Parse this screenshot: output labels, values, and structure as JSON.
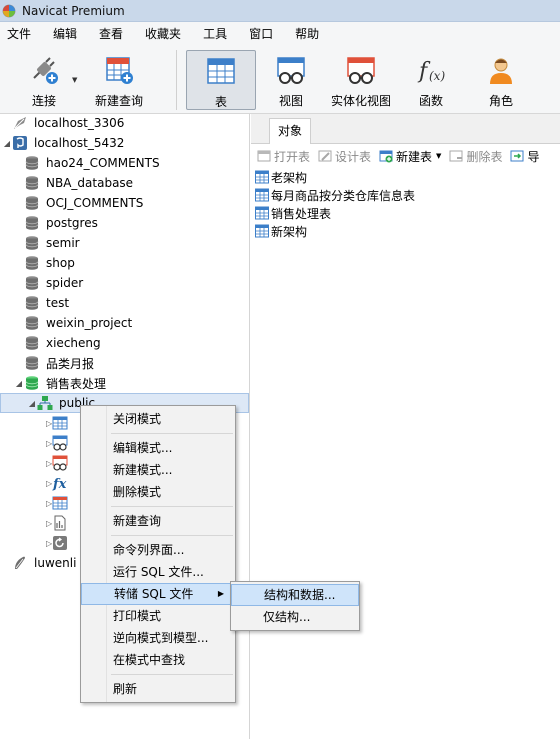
{
  "window": {
    "title": "Navicat Premium"
  },
  "menubar": [
    "文件",
    "编辑",
    "查看",
    "收藏夹",
    "工具",
    "窗口",
    "帮助"
  ],
  "toolbar": {
    "connect": "连接",
    "new_query": "新建查询",
    "table": "表",
    "view": "视图",
    "materialized_view": "实体化视图",
    "function": "函数",
    "role": "角色"
  },
  "tree": {
    "conn_mysql": "localhost_3306",
    "conn_pg": "localhost_5432",
    "databases": [
      "hao24_COMMENTS",
      "NBA_database",
      "OCJ_COMMENTS",
      "postgres",
      "semir",
      "shop",
      "spider",
      "test",
      "weixin_project",
      "xiecheng",
      "品类月报"
    ],
    "open_db": "销售表处理",
    "schema": "public",
    "conn_other": "luwenli"
  },
  "right": {
    "tab": "对象",
    "buttons": {
      "open": "打开表",
      "design": "设计表",
      "new": "新建表",
      "delete": "删除表",
      "import": "导"
    },
    "tables": [
      "老架构",
      "每月商品按分类仓库信息表",
      "销售处理表",
      "新架构"
    ]
  },
  "context_menu": {
    "close_schema": "关闭模式",
    "edit_schema": "编辑模式...",
    "new_schema": "新建模式...",
    "delete_schema": "删除模式",
    "new_query": "新建查询",
    "console": "命令列界面...",
    "run_sql": "运行 SQL 文件...",
    "dump_sql": "转储 SQL 文件",
    "print_schema": "打印模式",
    "reverse": "逆向模式到模型...",
    "find": "在模式中查找",
    "refresh": "刷新"
  },
  "submenu": {
    "structure_data": "结构和数据...",
    "structure_only": "仅结构..."
  },
  "colors": {
    "accent": "#3c7fc9",
    "db_gray": "#6e6e6e",
    "db_green": "#2fa84f",
    "highlight": "#cfe4fa"
  }
}
